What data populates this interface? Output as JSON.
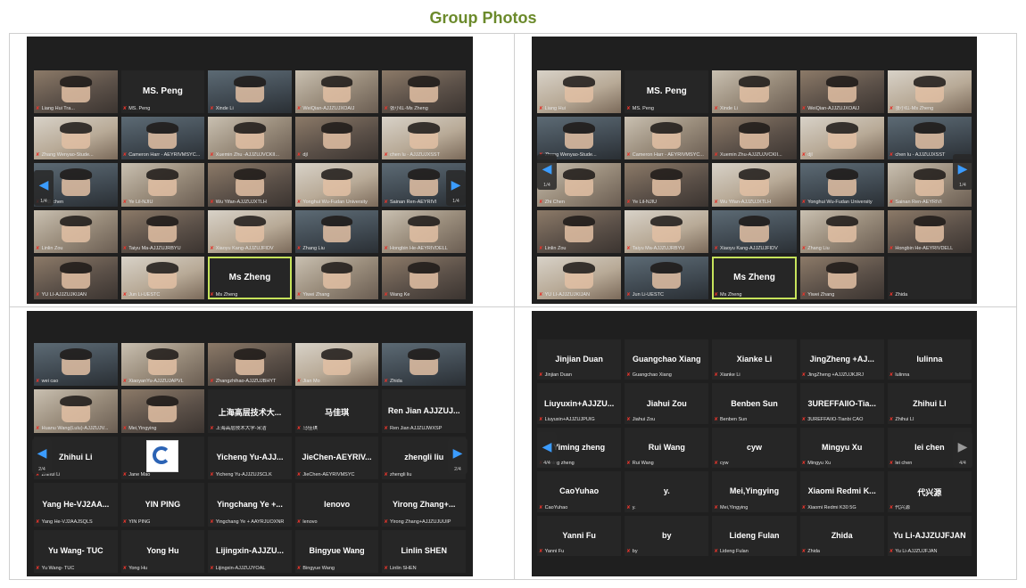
{
  "page_title": "Group Photos",
  "screens": [
    {
      "id": "s1",
      "page": "1/4",
      "tiles": [
        {
          "caption": "Liang Hui Tra...",
          "video": true
        },
        {
          "caption": "MS. Peng",
          "name": "MS. Peng"
        },
        {
          "caption": "Xinde Li",
          "video": true
        },
        {
          "caption": "WeiQian-AJJZUJXOAIJ",
          "video": true
        },
        {
          "caption": "张小红-Ms Zheng",
          "video": true
        },
        {
          "caption": "Zhang Wenyao-Stude...",
          "video": true
        },
        {
          "caption": "Cameron Harr - AEYRIVMSYC...",
          "video": true
        },
        {
          "caption": "Xuemin Zhu -AJJZUJVCKII...",
          "video": true
        },
        {
          "caption": "djl",
          "video": true
        },
        {
          "caption": "chen lu - AJJZUJXSST",
          "video": true
        },
        {
          "caption": "许草 chen",
          "video": true
        },
        {
          "caption": "Ye Lil-NJIU",
          "video": true
        },
        {
          "caption": "Wu Yifan-AJJZUJXTLH",
          "video": true
        },
        {
          "caption": "Yonghui Wu-Fudan University",
          "video": true
        },
        {
          "caption": "Sainan Ren-AEYRIVI",
          "video": true
        },
        {
          "caption": "Linlin Zou",
          "video": true
        },
        {
          "caption": "Taiyu Ma-AJJZUJRBYU",
          "video": true
        },
        {
          "caption": "Xiaoyu Kang-AJJZUJFIDV",
          "video": true
        },
        {
          "caption": "Zhang Liu",
          "video": true
        },
        {
          "caption": "Hongbin He-AEYRIVDELL",
          "video": true
        },
        {
          "caption": "YU LI-AJJZUJKIJAN",
          "video": true
        },
        {
          "caption": "Jun Li-UESTC",
          "video": true
        },
        {
          "caption": "Ms Zheng",
          "name": "Ms Zheng",
          "active": true
        },
        {
          "caption": "Yiwei Zhang",
          "video": true
        },
        {
          "caption": "Wang Ke",
          "video": true
        }
      ]
    },
    {
      "id": "s2",
      "page": "1/4",
      "tiles": [
        {
          "caption": "Liang Hui",
          "video": true
        },
        {
          "caption": "MS. Peng",
          "name": "MS. Peng"
        },
        {
          "caption": "Xinde Li",
          "video": true
        },
        {
          "caption": "WeiQian-AJJZUJXOAIJ",
          "video": true
        },
        {
          "caption": "张小红-Ms Zheng",
          "video": true
        },
        {
          "caption": "Zhang Wenyao-Stude...",
          "video": true
        },
        {
          "caption": "Cameron Harr - AEYRIVMSYC...",
          "video": true
        },
        {
          "caption": "Xuemin Zhu-AJJZUJVCKII...",
          "video": true
        },
        {
          "caption": "djl",
          "video": true
        },
        {
          "caption": "chen lu - AJJZUJXSST",
          "video": true
        },
        {
          "caption": "Zhi Chen",
          "video": true
        },
        {
          "caption": "Ye Lil-NJIU",
          "video": true
        },
        {
          "caption": "Wu Yifan-AJJZUJXTLH",
          "video": true
        },
        {
          "caption": "Yonghui Wu-Fudan University",
          "video": true
        },
        {
          "caption": "Sainan Ren-AEYRIVI",
          "video": true
        },
        {
          "caption": "Linlin Zou",
          "video": true
        },
        {
          "caption": "Taiyu Ma-AJJZUJRBYU",
          "video": true
        },
        {
          "caption": "Xiaoyu Kang-AJJZUJFIDV",
          "video": true
        },
        {
          "caption": "Zhang Liu",
          "video": true
        },
        {
          "caption": "Hongbin He-AEYRIVDELL",
          "video": true
        },
        {
          "caption": "YU LI-AJJZUJKIJAN",
          "video": true
        },
        {
          "caption": "Jun Li-UESTC",
          "video": true
        },
        {
          "caption": "Ms Zheng",
          "name": "Ms Zheng",
          "active": true
        },
        {
          "caption": "Yiwei Zhang",
          "video": true
        },
        {
          "caption": "Zhida",
          "empty": true
        }
      ]
    },
    {
      "id": "s3",
      "page": "2/4",
      "tiles": [
        {
          "caption": "wei cao",
          "video": true
        },
        {
          "caption": "XiaoyanYu-AJJZUJAPVL",
          "video": true
        },
        {
          "caption": "Zhangzhihao-AJJZUJBHYT",
          "video": true
        },
        {
          "caption": "Jian Mo",
          "video": true
        },
        {
          "caption": "Zhida",
          "video": true
        },
        {
          "caption": "Huanu Wang(Lulu)-AJJZUJV...",
          "video": true
        },
        {
          "caption": "Mei,Yingying",
          "video": true
        },
        {
          "caption": "上海高层技术大学-宋洁",
          "name": "上海高层技术大..."
        },
        {
          "caption": "马佳琪",
          "name": "马佳琪"
        },
        {
          "caption": "Ren Jian AJJZUJWXSP",
          "name": "Ren Jian AJJZUJ..."
        },
        {
          "caption": "Zhihui Li",
          "name": "Zhihui Li"
        },
        {
          "caption": "Jane Mao",
          "logo": true
        },
        {
          "caption": "Yicheng Yu-AJJZUJSCLK",
          "name": "Yicheng Yu-AJJ..."
        },
        {
          "caption": "JieChen-AEYRIVMSYC",
          "name": "JieChen-AEYRIV..."
        },
        {
          "caption": "zhengli liu",
          "name": "zhengli liu"
        },
        {
          "caption": "Yang He-VJ2AAJSQLS",
          "name": "Yang He-VJ2AA..."
        },
        {
          "caption": "YIN PING",
          "name": "YIN PING"
        },
        {
          "caption": "Yingchang Ye + AAYRJUOXNR",
          "name": "Yingchang Ye +..."
        },
        {
          "caption": "lenovo",
          "name": "lenovo"
        },
        {
          "caption": "Yirong Zhang+AJJZUJUUIP",
          "name": "Yirong Zhang+..."
        },
        {
          "caption": "Yu Wang- TUC",
          "name": "Yu Wang- TUC"
        },
        {
          "caption": "Yong Hu",
          "name": "Yong Hu"
        },
        {
          "caption": "Lijingxin-AJJZUJYOAL",
          "name": "Lijingxin-AJJZU..."
        },
        {
          "caption": "Bingyue Wang",
          "name": "Bingyue Wang"
        },
        {
          "caption": "Linlin SHEN",
          "name": "Linlin SHEN"
        }
      ]
    },
    {
      "id": "s4",
      "page": "4/4",
      "tiles": [
        {
          "caption": "Jinjian Duan",
          "name": "Jinjian Duan"
        },
        {
          "caption": "Guangchao Xiang",
          "name": "Guangchao Xiang"
        },
        {
          "caption": "Xianke Li",
          "name": "Xianke Li"
        },
        {
          "caption": "JingZheng +AJJZUJKJRJ",
          "name": "JingZheng +AJ..."
        },
        {
          "caption": "lulinna",
          "name": "lulinna"
        },
        {
          "caption": "Liuyuxin+AJJZUJPUIG",
          "name": "Liuyuxin+AJJZU..."
        },
        {
          "caption": "Jiahui Zou",
          "name": "Jiahui Zou"
        },
        {
          "caption": "Benben Sun",
          "name": "Benben Sun"
        },
        {
          "caption": "3UREFFAIIO-Tianbi CAO",
          "name": "3UREFFAIIO-Tia..."
        },
        {
          "caption": "Zhihui LI",
          "name": "Zhihui LI"
        },
        {
          "caption": "Yiming zheng",
          "name": "Yiming zheng"
        },
        {
          "caption": "Rui Wang",
          "name": "Rui Wang"
        },
        {
          "caption": "cyw",
          "name": "cyw"
        },
        {
          "caption": "Mingyu Xu",
          "name": "Mingyu Xu"
        },
        {
          "caption": "lei chen",
          "name": "lei chen"
        },
        {
          "caption": "CaoYuhao",
          "name": "CaoYuhao"
        },
        {
          "caption": "y.",
          "name": "y."
        },
        {
          "caption": "Mei,Yingying",
          "name": "Mei,Yingying"
        },
        {
          "caption": "Xiaomi Redmi K30 5G",
          "name": "Xiaomi Redmi K..."
        },
        {
          "caption": "代兴源",
          "name": "代兴源"
        },
        {
          "caption": "Yanni Fu",
          "name": "Yanni Fu"
        },
        {
          "caption": "by",
          "name": "by"
        },
        {
          "caption": "Lideng Fulan",
          "name": "Lideng Fulan"
        },
        {
          "caption": "Zhida",
          "name": "Zhida"
        },
        {
          "caption": "Yu Li-AJJZUJFJAN",
          "name": "Yu Li-AJJZUJFJAN"
        }
      ]
    }
  ],
  "icons": {
    "prev": "chevron-left-icon",
    "next": "chevron-right-icon",
    "mic": "mic-muted-icon"
  },
  "colors": {
    "title": "#6b8a2b",
    "active_border": "#c6e35b",
    "nav_arrow": "#3b9cff",
    "mic_muted": "#e3352c"
  }
}
